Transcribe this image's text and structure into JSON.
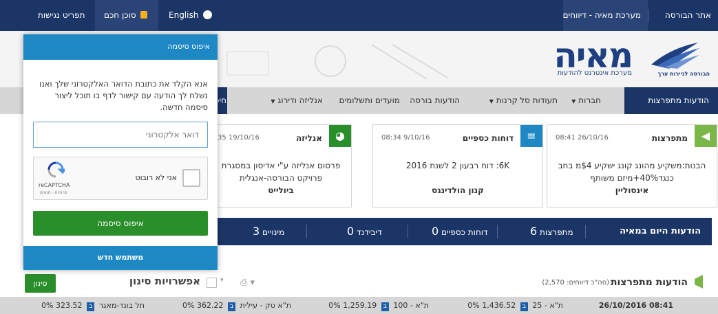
{
  "topbar": {
    "site": "אתר הבורסה",
    "maya_reports": "מערכת מאיה - דיווחים",
    "english": "English",
    "smart_agent": "סוכן חכם",
    "accessibility": "תפריט נגישות",
    "colors": {
      "bg": "#1b3567"
    }
  },
  "header": {
    "logo": "מאיה",
    "logo_sub": "מערכת אינטרנט להודעות",
    "tase": "הבורסה לניירות ערך"
  },
  "nav": {
    "items": [
      "הודעות מתפרצות",
      "חברות",
      "תעודות סל",
      "קרנות",
      "הודעות בורסה",
      "מועדים ותשלומים",
      "אנליזה ודירוג",
      "חיפ"
    ]
  },
  "cards": [
    {
      "title": "מתפרצות",
      "date": "08:41 26/10/16",
      "body": "הבנות:משקיע מהונג קונג ישקיע $4מ בחב כנגד40%+מיזם משותף",
      "company": "אינסוליין",
      "icon": "megaphone-icon",
      "color": "#7ab648"
    },
    {
      "title": "דוחות כספיים",
      "date": "08:34 9/10/16",
      "body": "6K: דוח רבעון 2 לשנת 2016",
      "company": "קנון הולדינגס",
      "icon": "coins-icon",
      "color": "#1e88c4"
    },
    {
      "title": "אנליזה",
      "date": "35 19/10/16",
      "body": "פרסום אנליזה ע\"י אדיסון במסגרת פרויקט הבורסה-אנגלית",
      "company": "ביולייט",
      "icon": "pie-icon",
      "color": "#2a8e2a"
    }
  ],
  "today": {
    "label": "הודעות היום במאיה",
    "stats": [
      {
        "num": "6",
        "label": "מתפרצות"
      },
      {
        "num": "0",
        "label": "דוחות כספיים"
      },
      {
        "num": "0",
        "label": "דיבידנד"
      },
      {
        "num": "3",
        "label": "מינויים"
      }
    ]
  },
  "filter": {
    "title": "הודעות מתפרצות",
    "total": "(סה\"כ דיווחים: 2,570)",
    "options": "אפשרויות סינון",
    "button": "סינון"
  },
  "ticker": {
    "time": "26/10/2016 08:41",
    "items": [
      {
        "name": "ת\"א - 25",
        "value": "1,436.52",
        "change": "0%"
      },
      {
        "name": "ת\"א - 100",
        "value": "1,259.19",
        "change": "0%"
      },
      {
        "name": "ת\"א טק - עילית",
        "value": "362.22",
        "change": "0%"
      },
      {
        "name": "תל בונד-מאגר",
        "value": "323.52",
        "change": "0%"
      }
    ],
    "badge": "ב"
  },
  "panel": {
    "title": "איפוס סיסמה",
    "instructions": "אנא הקלד את כתובת הדואר האלקטרוני שלך ואנו נשלח לך הודעה עם קישור לדף בו תוכל ליצור סיסמה חדשה.",
    "email_placeholder": "דואר אלקטרוני",
    "captcha_label": "אני לא רובוט",
    "captcha_brand": "reCAPTCHA",
    "captcha_links": "פרטיות - תנאים",
    "reset_button": "איפוס סיסמה",
    "new_user": "משתמש חדש"
  }
}
